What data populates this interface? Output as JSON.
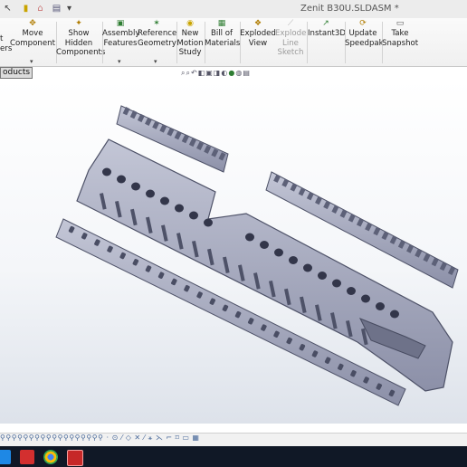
{
  "window": {
    "title": "Zenit B30U.SLDASM *"
  },
  "ribbon": {
    "partial_left_label": "t\ners",
    "buttons": [
      {
        "id": "move-component",
        "label": "Move\nComponent",
        "icon": "move-icon",
        "enabled": true
      },
      {
        "id": "show-hidden",
        "label": "Show\nHidden\nComponents",
        "icon": "show-hidden-icon",
        "enabled": true
      },
      {
        "id": "assembly-features",
        "label": "Assembly\nFeatures",
        "icon": "assembly-features-icon",
        "enabled": true
      },
      {
        "id": "reference-geometry",
        "label": "Reference\nGeometry",
        "icon": "reference-geometry-icon",
        "enabled": true
      },
      {
        "id": "new-motion-study",
        "label": "New\nMotion\nStudy",
        "icon": "motion-study-icon",
        "enabled": true
      },
      {
        "id": "bill-of-materials",
        "label": "Bill of\nMaterials",
        "icon": "bom-icon",
        "enabled": true
      },
      {
        "id": "exploded-view",
        "label": "Exploded\nView",
        "icon": "exploded-view-icon",
        "enabled": true
      },
      {
        "id": "explode-line-sketch",
        "label": "Explode\nLine\nSketch",
        "icon": "explode-line-icon",
        "enabled": false
      },
      {
        "id": "instant3d",
        "label": "Instant3D",
        "icon": "instant3d-icon",
        "enabled": true
      },
      {
        "id": "update-speedpak",
        "label": "Update\nSpeedpak",
        "icon": "speedpak-icon",
        "enabled": true
      },
      {
        "id": "take-snapshot",
        "label": "Take\nSnapshot",
        "icon": "snapshot-icon",
        "enabled": true
      }
    ]
  },
  "tab": {
    "label": "oducts"
  },
  "view_toolbar": {
    "icons": [
      "zoom-fit-icon",
      "zoom-area-icon",
      "previous-view-icon",
      "section-view-icon",
      "view-orientation-icon",
      "display-style-icon",
      "hide-show-icon",
      "appearance-icon",
      "scene-icon",
      "view-settings-icon"
    ]
  },
  "colors": {
    "ribbon_bg": "#f2f2f2",
    "part_fill": "#9ea2b8",
    "part_dark": "#5d6178",
    "taskbar_bg": "#101826",
    "accent_red": "#c62828"
  }
}
